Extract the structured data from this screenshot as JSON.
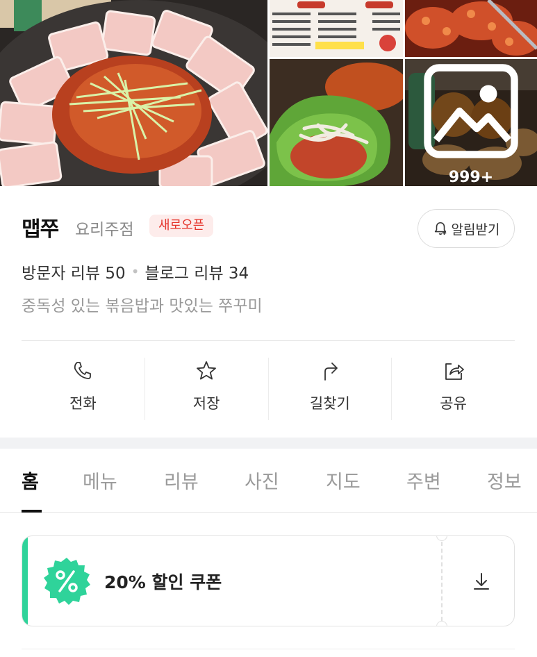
{
  "gallery": {
    "more_count": "999+",
    "icons": {
      "more": "image-icon"
    }
  },
  "place": {
    "name": "맵쭈",
    "category": "요리주점",
    "badge": "새로오픈",
    "notify_label": "알림받기",
    "visitor_reviews": "방문자 리뷰 50",
    "blog_reviews": "블로그 리뷰 34",
    "tagline": "중독성 있는 볶음밥과 맛있는 쭈꾸미"
  },
  "actions": [
    {
      "label": "전화",
      "icon": "phone-icon"
    },
    {
      "label": "저장",
      "icon": "star-icon"
    },
    {
      "label": "길찾기",
      "icon": "directions-icon"
    },
    {
      "label": "공유",
      "icon": "share-icon"
    }
  ],
  "tabs": [
    {
      "label": "홈",
      "active": true
    },
    {
      "label": "메뉴"
    },
    {
      "label": "리뷰"
    },
    {
      "label": "사진"
    },
    {
      "label": "지도"
    },
    {
      "label": "주변"
    },
    {
      "label": "정보"
    }
  ],
  "coupon": {
    "text": "20% 할인 쿠폰",
    "seal_symbol": "%",
    "accent": "#2fd39a"
  },
  "colors": {
    "badge_text": "#e5332a",
    "badge_bg": "#fdeceb"
  }
}
